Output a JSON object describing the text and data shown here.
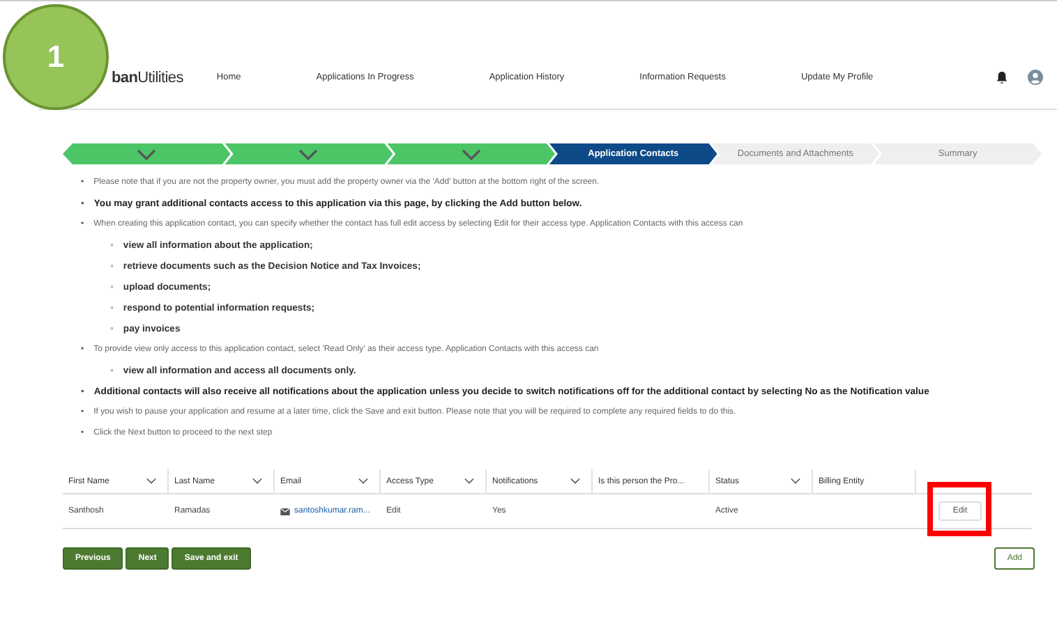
{
  "step_badge": "1",
  "logo": {
    "bold_part": "ban",
    "light_part": "Utilities"
  },
  "nav": [
    "Home",
    "Applications In Progress",
    "Application History",
    "Information Requests",
    "Update My Profile"
  ],
  "steps": [
    {
      "completed": true,
      "selected": false
    },
    {
      "completed": true,
      "selected": false
    },
    {
      "completed": true,
      "selected": false
    },
    {
      "label": "Application Contacts",
      "completed": false,
      "selected": true
    },
    {
      "label": "Documents and Attachments",
      "completed": false,
      "selected": false
    },
    {
      "label": "Summary",
      "completed": false,
      "selected": false
    }
  ],
  "instructions": [
    {
      "kind": "note",
      "marker": "•",
      "text": "Please note that if you are not the property owner, you must add the property owner via the 'Add' button at the bottom right of the screen."
    },
    {
      "kind": "strong",
      "marker": "•",
      "text": "You may grant additional contacts access to this application via this page, by clicking the Add button below."
    },
    {
      "kind": "note",
      "marker": "•",
      "text": "When creating this application contact, you can specify whether the contact has full edit access by selecting Edit for their access type. Application Contacts with this access can",
      "children": [
        {
          "marker": "◦",
          "text": "view all information about the application;"
        },
        {
          "marker": "◦",
          "text": "retrieve documents such as the Decision Notice and Tax Invoices;"
        },
        {
          "marker": "◦",
          "text": "upload documents;"
        },
        {
          "marker": "◦",
          "text": "respond to potential information requests;"
        },
        {
          "marker": "◦",
          "text": "pay invoices"
        }
      ]
    },
    {
      "kind": "note",
      "marker": "•",
      "text": "To provide view only access to this application contact, select 'Read Only' as their access type. Application Contacts with this access can",
      "children": [
        {
          "marker": "◦",
          "text": "view all information and access all documents only."
        }
      ]
    },
    {
      "kind": "strong",
      "marker": "•",
      "text": "Additional contacts will also receive all notifications about the application unless you decide to switch notifications off for the additional contact by selecting No as the Notification value"
    },
    {
      "kind": "note",
      "marker": "•",
      "text": "If you wish to pause your application and resume at a later time, click the Save and exit button. Please note that you will be required to complete any required fields to do this."
    },
    {
      "kind": "note",
      "marker": "•",
      "text": "Click the Next button to proceed to the next step"
    }
  ],
  "table": {
    "columns": [
      {
        "label": "First Name",
        "sortable": true
      },
      {
        "label": "Last Name",
        "sortable": true
      },
      {
        "label": "Email",
        "sortable": true
      },
      {
        "label": "Access Type",
        "sortable": true
      },
      {
        "label": "Notifications",
        "sortable": true
      },
      {
        "label": "Is this person the Pro...",
        "sortable": false
      },
      {
        "label": "Status",
        "sortable": true
      },
      {
        "label": "Billing Entity",
        "sortable": false
      }
    ],
    "rows": [
      {
        "first_name": "Santhosh",
        "last_name": "Ramadas",
        "email": "santoshkumar.ram...",
        "access_type": "Edit",
        "notifications": "Yes",
        "status": "Active",
        "action": "Edit",
        "highlighted": true
      }
    ]
  },
  "buttons": [
    {
      "label": "Previous",
      "kind": "primary"
    },
    {
      "label": "Next",
      "kind": "primary"
    },
    {
      "label": "Save and exit",
      "kind": "primary"
    },
    {
      "label": "Add",
      "kind": "outline"
    }
  ]
}
